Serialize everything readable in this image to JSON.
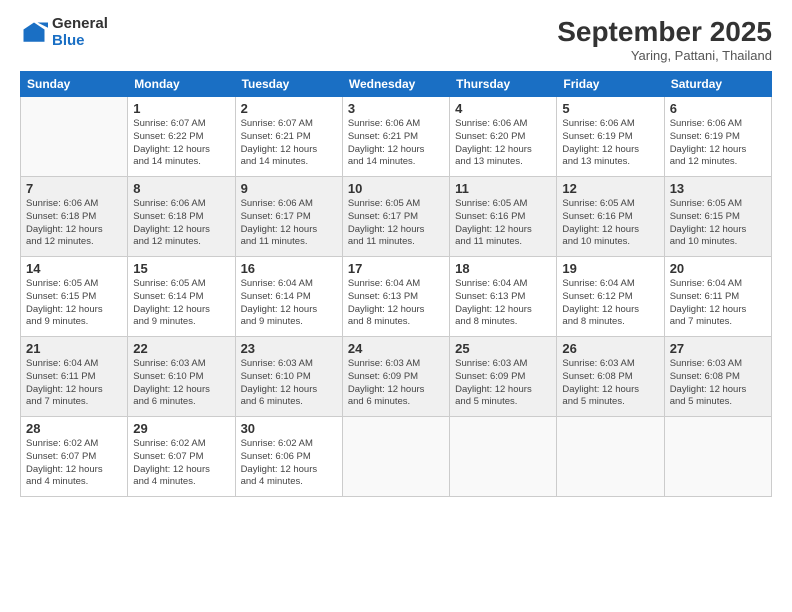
{
  "logo": {
    "general": "General",
    "blue": "Blue"
  },
  "header": {
    "month": "September 2025",
    "location": "Yaring, Pattani, Thailand"
  },
  "days_of_week": [
    "Sunday",
    "Monday",
    "Tuesday",
    "Wednesday",
    "Thursday",
    "Friday",
    "Saturday"
  ],
  "weeks": [
    [
      {
        "day": "",
        "info": ""
      },
      {
        "day": "1",
        "info": "Sunrise: 6:07 AM\nSunset: 6:22 PM\nDaylight: 12 hours\nand 14 minutes."
      },
      {
        "day": "2",
        "info": "Sunrise: 6:07 AM\nSunset: 6:21 PM\nDaylight: 12 hours\nand 14 minutes."
      },
      {
        "day": "3",
        "info": "Sunrise: 6:06 AM\nSunset: 6:21 PM\nDaylight: 12 hours\nand 14 minutes."
      },
      {
        "day": "4",
        "info": "Sunrise: 6:06 AM\nSunset: 6:20 PM\nDaylight: 12 hours\nand 13 minutes."
      },
      {
        "day": "5",
        "info": "Sunrise: 6:06 AM\nSunset: 6:19 PM\nDaylight: 12 hours\nand 13 minutes."
      },
      {
        "day": "6",
        "info": "Sunrise: 6:06 AM\nSunset: 6:19 PM\nDaylight: 12 hours\nand 12 minutes."
      }
    ],
    [
      {
        "day": "7",
        "info": "Sunrise: 6:06 AM\nSunset: 6:18 PM\nDaylight: 12 hours\nand 12 minutes."
      },
      {
        "day": "8",
        "info": "Sunrise: 6:06 AM\nSunset: 6:18 PM\nDaylight: 12 hours\nand 12 minutes."
      },
      {
        "day": "9",
        "info": "Sunrise: 6:06 AM\nSunset: 6:17 PM\nDaylight: 12 hours\nand 11 minutes."
      },
      {
        "day": "10",
        "info": "Sunrise: 6:05 AM\nSunset: 6:17 PM\nDaylight: 12 hours\nand 11 minutes."
      },
      {
        "day": "11",
        "info": "Sunrise: 6:05 AM\nSunset: 6:16 PM\nDaylight: 12 hours\nand 11 minutes."
      },
      {
        "day": "12",
        "info": "Sunrise: 6:05 AM\nSunset: 6:16 PM\nDaylight: 12 hours\nand 10 minutes."
      },
      {
        "day": "13",
        "info": "Sunrise: 6:05 AM\nSunset: 6:15 PM\nDaylight: 12 hours\nand 10 minutes."
      }
    ],
    [
      {
        "day": "14",
        "info": "Sunrise: 6:05 AM\nSunset: 6:15 PM\nDaylight: 12 hours\nand 9 minutes."
      },
      {
        "day": "15",
        "info": "Sunrise: 6:05 AM\nSunset: 6:14 PM\nDaylight: 12 hours\nand 9 minutes."
      },
      {
        "day": "16",
        "info": "Sunrise: 6:04 AM\nSunset: 6:14 PM\nDaylight: 12 hours\nand 9 minutes."
      },
      {
        "day": "17",
        "info": "Sunrise: 6:04 AM\nSunset: 6:13 PM\nDaylight: 12 hours\nand 8 minutes."
      },
      {
        "day": "18",
        "info": "Sunrise: 6:04 AM\nSunset: 6:13 PM\nDaylight: 12 hours\nand 8 minutes."
      },
      {
        "day": "19",
        "info": "Sunrise: 6:04 AM\nSunset: 6:12 PM\nDaylight: 12 hours\nand 8 minutes."
      },
      {
        "day": "20",
        "info": "Sunrise: 6:04 AM\nSunset: 6:11 PM\nDaylight: 12 hours\nand 7 minutes."
      }
    ],
    [
      {
        "day": "21",
        "info": "Sunrise: 6:04 AM\nSunset: 6:11 PM\nDaylight: 12 hours\nand 7 minutes."
      },
      {
        "day": "22",
        "info": "Sunrise: 6:03 AM\nSunset: 6:10 PM\nDaylight: 12 hours\nand 6 minutes."
      },
      {
        "day": "23",
        "info": "Sunrise: 6:03 AM\nSunset: 6:10 PM\nDaylight: 12 hours\nand 6 minutes."
      },
      {
        "day": "24",
        "info": "Sunrise: 6:03 AM\nSunset: 6:09 PM\nDaylight: 12 hours\nand 6 minutes."
      },
      {
        "day": "25",
        "info": "Sunrise: 6:03 AM\nSunset: 6:09 PM\nDaylight: 12 hours\nand 5 minutes."
      },
      {
        "day": "26",
        "info": "Sunrise: 6:03 AM\nSunset: 6:08 PM\nDaylight: 12 hours\nand 5 minutes."
      },
      {
        "day": "27",
        "info": "Sunrise: 6:03 AM\nSunset: 6:08 PM\nDaylight: 12 hours\nand 5 minutes."
      }
    ],
    [
      {
        "day": "28",
        "info": "Sunrise: 6:02 AM\nSunset: 6:07 PM\nDaylight: 12 hours\nand 4 minutes."
      },
      {
        "day": "29",
        "info": "Sunrise: 6:02 AM\nSunset: 6:07 PM\nDaylight: 12 hours\nand 4 minutes."
      },
      {
        "day": "30",
        "info": "Sunrise: 6:02 AM\nSunset: 6:06 PM\nDaylight: 12 hours\nand 4 minutes."
      },
      {
        "day": "",
        "info": ""
      },
      {
        "day": "",
        "info": ""
      },
      {
        "day": "",
        "info": ""
      },
      {
        "day": "",
        "info": ""
      }
    ]
  ]
}
